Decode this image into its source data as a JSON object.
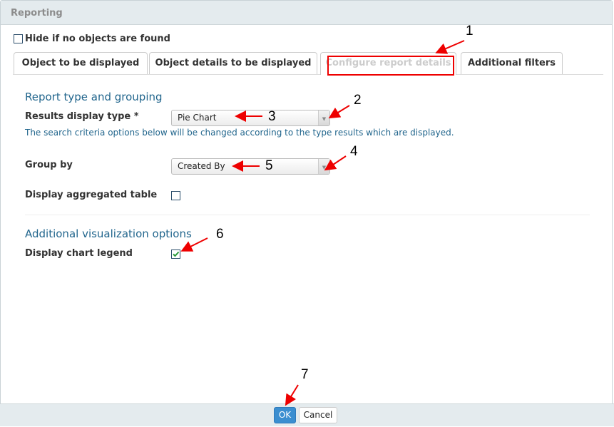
{
  "window": {
    "title": "Reporting"
  },
  "hide_if_empty": {
    "label": "Hide if no objects are found",
    "checked": false
  },
  "tabs": [
    {
      "label": "Object to be displayed",
      "active": false
    },
    {
      "label": "Object details to be displayed",
      "active": false
    },
    {
      "label": "Configure report details",
      "active": true
    },
    {
      "label": "Additional filters",
      "active": false
    }
  ],
  "report_section": {
    "title": "Report type and grouping",
    "results_display_type": {
      "label": "Results display type *",
      "value": "Pie Chart"
    },
    "hint": "The search criteria options below will be changed according to the type results which are displayed.",
    "group_by": {
      "label": "Group by",
      "value": "Created By"
    },
    "aggregated_table": {
      "label": "Display aggregated table",
      "checked": false
    }
  },
  "visualization_section": {
    "title": "Additional visualization options",
    "chart_legend": {
      "label": "Display chart legend",
      "checked": true
    }
  },
  "footer": {
    "ok": "OK",
    "cancel": "Cancel"
  },
  "annotations": [
    "1",
    "2",
    "3",
    "4",
    "5",
    "6",
    "7"
  ],
  "colors": {
    "accent": "#22668d",
    "ok_button": "#3b8ed0",
    "annotation": "#ee0000"
  }
}
